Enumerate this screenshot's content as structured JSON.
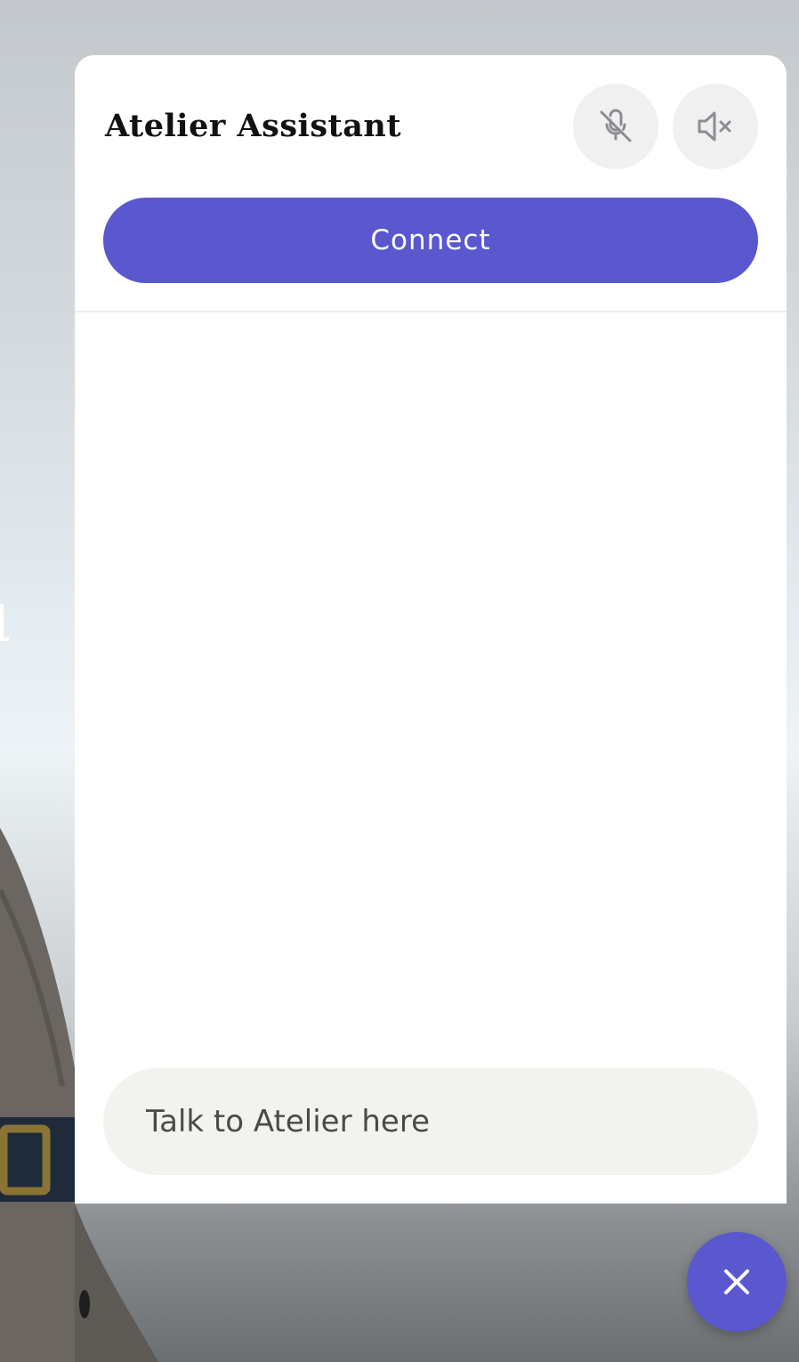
{
  "panel": {
    "title": "Atelier Assistant",
    "mic_button_icon": "mic-off-icon",
    "speaker_button_icon": "speaker-mute-icon",
    "connect_label": "Connect",
    "input_placeholder": "Talk to Atelier here",
    "input_value": ""
  },
  "fab": {
    "icon": "close-icon"
  },
  "colors": {
    "accent": "#5a57cf",
    "icon_button_bg": "#f0f0f1",
    "input_bg": "#f2f2ef",
    "panel_bg": "#ffffff",
    "title": "#111111"
  }
}
